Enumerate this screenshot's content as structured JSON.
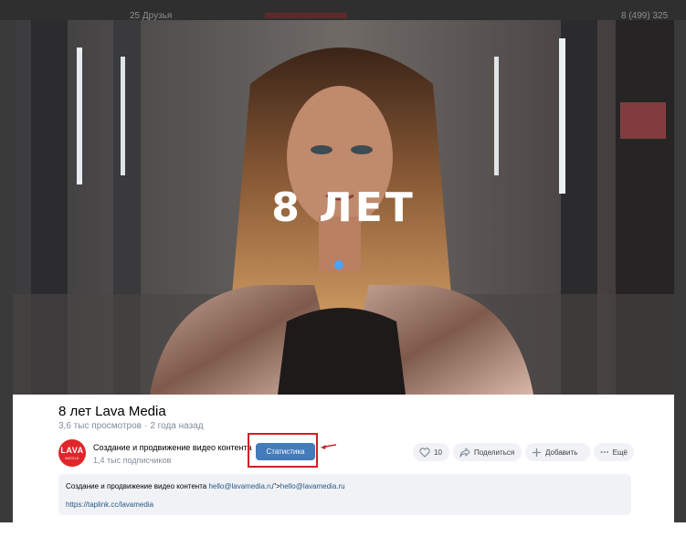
{
  "background": {
    "left_text": "25 Друзья",
    "right_text": "8 (499) 325"
  },
  "video": {
    "overlay_title": "8 ЛЕТ"
  },
  "info": {
    "title": "8 лет Lava Media",
    "views": "3,6 тыс просмотров",
    "separator": "·",
    "posted": "2 года назад"
  },
  "channel": {
    "avatar_line1": "LAVA",
    "avatar_line2": "MEDIA",
    "name": "Создание и продвижение видео контента",
    "subscribers": "1,4 тыс подписчиков"
  },
  "actions": {
    "stats_label": "Статистика",
    "like_count": "10",
    "share_label": "Поделиться",
    "add_label": "Добавить",
    "more_label": "Ещё"
  },
  "description": {
    "text": "Создание и продвижение видео контента ",
    "email_link": "hello@lavamedia.ru",
    "middle": "\">",
    "email_link2": "hello@lavamedia.ru",
    "url": "https://taplink.cc/lavamedia"
  },
  "colors": {
    "stats_button": "#447bba",
    "highlight": "#d01f25",
    "link": "#2a5885",
    "muted": "#818c99"
  }
}
